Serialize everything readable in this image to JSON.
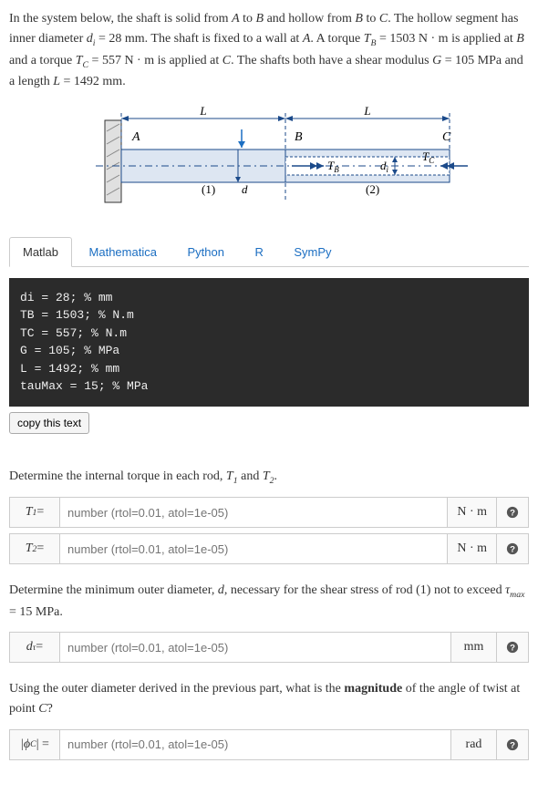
{
  "problem": {
    "intro1": "In the system below, the shaft is solid from ",
    "A": "A",
    "to": " to ",
    "B": "B",
    "intro2": " and hollow from ",
    "to2": " to ",
    "C": "C",
    "intro3": ". The hollow segment has inner diameter ",
    "di_sym": "d",
    "di_sub": "i",
    "di_eq": " = 28 mm",
    "intro4": ". The shaft is fixed to a wall at ",
    "intro5": ". A torque ",
    "TB_sym": "T",
    "TB_sub": "B",
    "TB_eq": " = 1503 N · m",
    "intro6": " is applied at ",
    "intro7": " and a torque ",
    "TC_sym": "T",
    "TC_sub": "C",
    "TC_eq": " = 557 N · m",
    "intro8": " is applied at ",
    "intro9": ". The shafts both have a shear modulus ",
    "G_sym": "G",
    "G_eq": " = 105 MPa",
    "intro10": " and a length ",
    "L_sym": "L",
    "L_eq": " = 1492 mm",
    "period": "."
  },
  "diagram": {
    "A": "A",
    "B": "B",
    "C": "C",
    "L1": "L",
    "L2": "L",
    "TB": "T",
    "TB_sub": "B",
    "TC": "T",
    "TC_sub": "C",
    "di": "d",
    "di_sub": "i",
    "d": "d",
    "seg1": "(1)",
    "seg2": "(2)"
  },
  "tabs": [
    "Matlab",
    "Mathematica",
    "Python",
    "R",
    "SymPy"
  ],
  "code": "di = 28; % mm\nTB = 1503; % N.m\nTC = 557; % N.m\nG = 105; % MPa\nL = 1492; % mm\ntauMax = 15; % MPa",
  "copy_label": "copy this text",
  "q1": {
    "text1": "Determine the internal torque in each rod, ",
    "T1": "T",
    "T1_sub": "1",
    "and": " and ",
    "T2": "T",
    "T2_sub": "2",
    "period": "."
  },
  "a1_label_sym": "T",
  "a1_label_sub": "1",
  "a1_label_eq": " =",
  "a2_label_sym": "T",
  "a2_label_sub": "2",
  "a2_label_eq": " =",
  "placeholder": "number (rtol=0.01, atol=1e-05)",
  "unit_Nm": "N · m",
  "q2": {
    "text1": "Determine the minimum outer diameter, ",
    "d": "d",
    "text2": ", necessary for the shear stress of rod ",
    "rod1": "(1)",
    "text3": " not to exceed ",
    "tau": "τ",
    "tau_sub": "max",
    "tau_eq": " = 15 MPa",
    "period": "."
  },
  "a3_label_sym": "d",
  "a3_label_sub": "τ",
  "a3_label_eq": " =",
  "unit_mm": "mm",
  "q3": {
    "text1": "Using the outer diameter derived in the previous part, what is the ",
    "bold": "magnitude",
    "text2": " of the angle of twist at point ",
    "C": "C",
    "q": "?"
  },
  "a4_label": "|ϕ",
  "a4_label_sub": "C",
  "a4_label_eq": "| =",
  "unit_rad": "rad"
}
